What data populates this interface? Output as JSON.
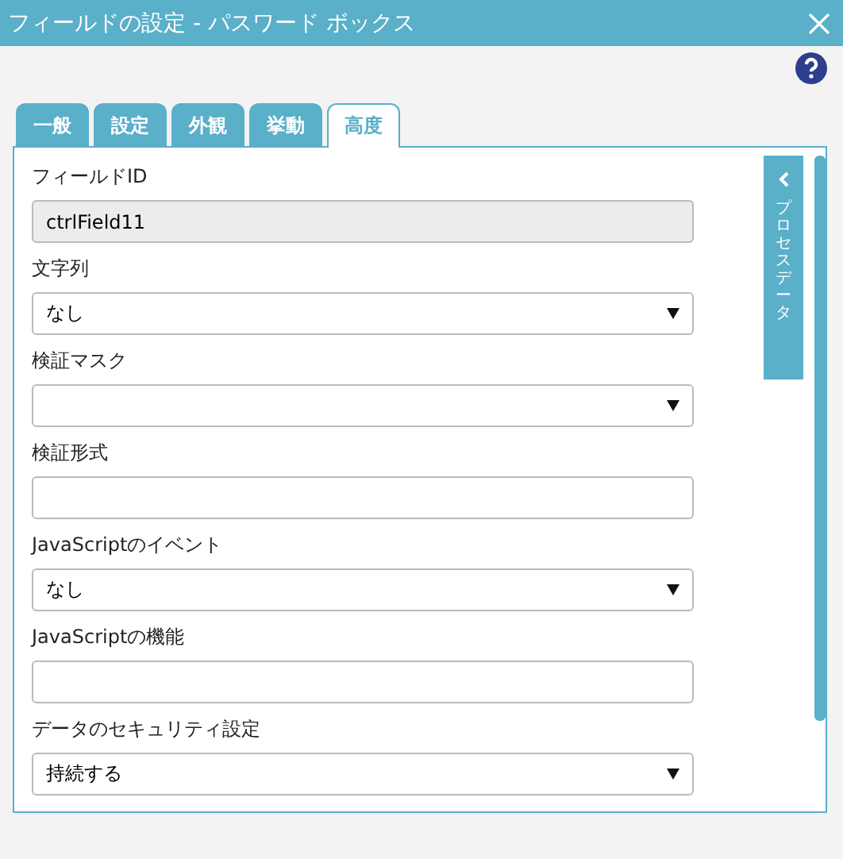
{
  "window": {
    "title": "フィールドの設定 - パスワード ボックス"
  },
  "tabs": [
    {
      "label": "一般",
      "selected": false
    },
    {
      "label": "設定",
      "selected": false
    },
    {
      "label": "外観",
      "selected": false
    },
    {
      "label": "挙動",
      "selected": false
    },
    {
      "label": "高度",
      "selected": true
    }
  ],
  "side_panel": {
    "label": "プロセスデータ"
  },
  "fields": [
    {
      "label": "フィールドID",
      "kind": "readonly",
      "value": "ctrlField11"
    },
    {
      "label": "文字列",
      "kind": "select",
      "value": "なし"
    },
    {
      "label": "検証マスク",
      "kind": "select"
    },
    {
      "label": "検証形式",
      "kind": "text"
    },
    {
      "label": "JavaScriptのイベント",
      "kind": "select",
      "value": "なし"
    },
    {
      "label": "JavaScriptの機能",
      "kind": "text"
    },
    {
      "label": "データのセキュリティ設定",
      "kind": "select",
      "value": "持続する"
    }
  ]
}
